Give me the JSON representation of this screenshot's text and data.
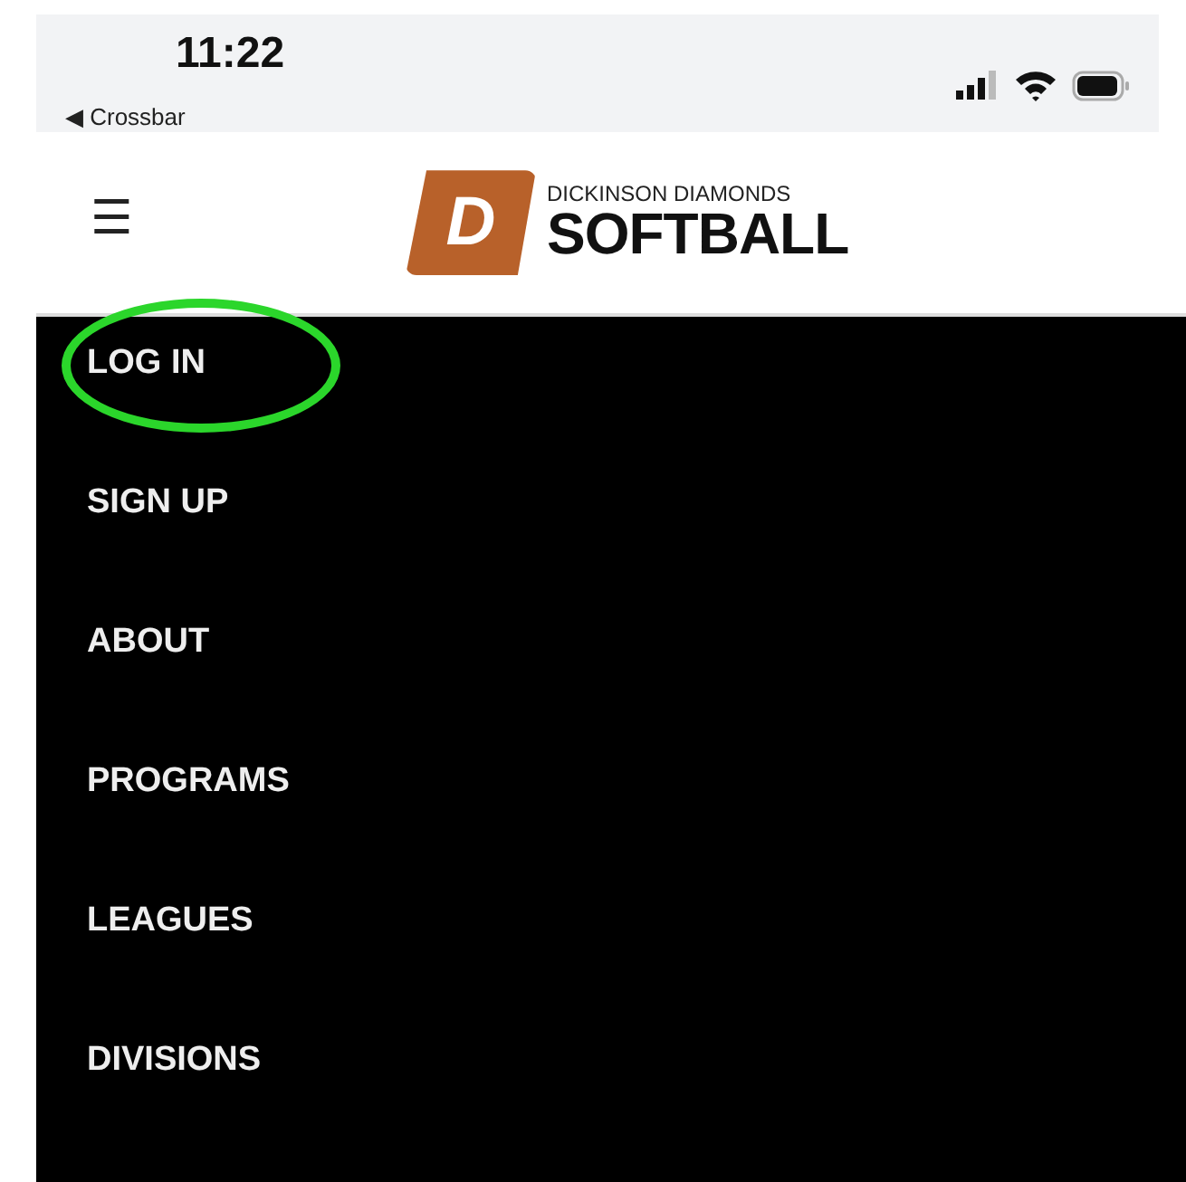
{
  "status_bar": {
    "time": "11:22",
    "back_label": "◀ Crossbar"
  },
  "header": {
    "menu_glyph": "☰",
    "logo_top": "DICKINSON DIAMONDS",
    "logo_main": "SOFTBALL",
    "logo_letter": "D"
  },
  "menu": [
    {
      "label": "LOG IN",
      "circled": true
    },
    {
      "label": "SIGN UP",
      "circled": false
    },
    {
      "label": "ABOUT",
      "circled": false
    },
    {
      "label": "PROGRAMS",
      "circled": false
    },
    {
      "label": "LEAGUES",
      "circled": false
    },
    {
      "label": "DIVISIONS",
      "circled": false
    }
  ]
}
